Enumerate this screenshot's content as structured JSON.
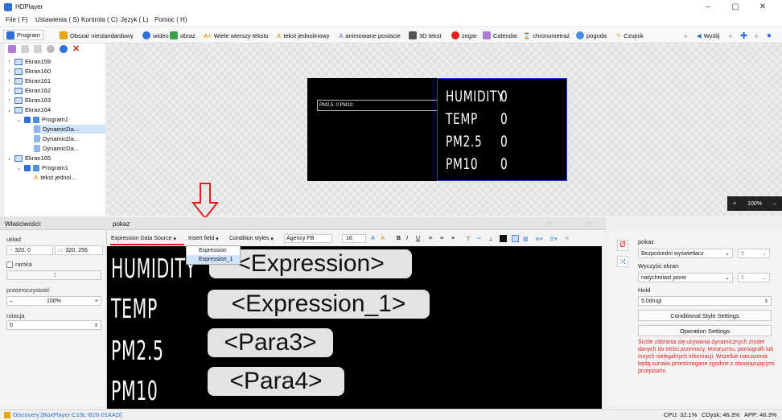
{
  "window": {
    "title": "HDPlayer",
    "controls": [
      "–",
      "▢",
      "✕"
    ]
  },
  "menu": [
    "File ( F)",
    "Ustawienia ( S)",
    "Kontrola ( C)",
    "Język ( L)",
    "Pomoc ( H)"
  ],
  "toolbar": {
    "program": "Program",
    "items": [
      "Obszar niestandardowy",
      "wideo",
      "obraz",
      "Wiele wierszy tekstu",
      "tekst jednolinowy",
      "animowane postacie",
      "3D tekst",
      "zegar",
      "Calendar",
      "chronometraż",
      "pogoda",
      "Czujnik"
    ],
    "send": "Wyślij"
  },
  "tree": [
    {
      "label": "Ekran159",
      "level": 0,
      "expanded": false
    },
    {
      "label": "Ekran160",
      "level": 0,
      "expanded": false
    },
    {
      "label": "Ekran161",
      "level": 0,
      "expanded": false
    },
    {
      "label": "Ekran162",
      "level": 0,
      "expanded": false
    },
    {
      "label": "Ekran163",
      "level": 0,
      "expanded": false
    },
    {
      "label": "Ekran164",
      "level": 0,
      "expanded": true
    },
    {
      "label": "Program1",
      "level": 1,
      "expanded": true
    },
    {
      "label": "DynamicDa...",
      "level": 2,
      "selected": true
    },
    {
      "label": "DynamicDa...",
      "level": 2
    },
    {
      "label": "DynamicDa...",
      "level": 2
    },
    {
      "label": "Ekran165",
      "level": 0,
      "expanded": true
    },
    {
      "label": "Program1",
      "level": 1,
      "expanded": true
    },
    {
      "label": "tekst jednol...",
      "level": 2,
      "text": true
    }
  ],
  "preview": {
    "box_text": "PM2.5: 0  PM10:",
    "rows": [
      {
        "label": "HUMIDITY",
        "value": "0"
      },
      {
        "label": "TEMP",
        "value": "0"
      },
      {
        "label": "PM2.5",
        "value": "0"
      },
      {
        "label": "PM10",
        "value": "0"
      }
    ],
    "zoom": "100%",
    "zoom_plus": "+",
    "zoom_minus": "–"
  },
  "properties": {
    "title": "Właściwości:",
    "layout_label": "układ",
    "x": "320, 0",
    "size": "320, 256",
    "frame_label": "ramka",
    "frame_value": "1",
    "transparency_label": "przezroczystość",
    "transparency_value": "100%",
    "rotation_label": "rotacja",
    "rotation_value": "0"
  },
  "editor": {
    "title": "pokaz",
    "toolbar": {
      "data_source": "Expression Data Source",
      "insert_field": "Insert field",
      "condition_styles": "Condition styles",
      "font": "Agency FB",
      "size": "16"
    },
    "dropdown_items": [
      "Expression",
      "Expression_1"
    ],
    "rows": [
      {
        "label": "HUMIDITY",
        "field": "<Expression>"
      },
      {
        "label": "TEMP",
        "field": "<Expression_1>"
      },
      {
        "label": "PM2.5",
        "field": "<Para3>"
      },
      {
        "label": "PM10",
        "field": "<Para4>"
      }
    ]
  },
  "right_panel": {
    "show_label": "pokaz",
    "show_value": "Bezpośredni wyświetlacz",
    "show_speed": "5",
    "clear_label": "Wyczyść ekran",
    "clear_value": "natychmiast jasne",
    "clear_speed": "5",
    "hold_label": "Hold",
    "hold_value": "5.0drugi",
    "cond_btn": "Conditional Style Settings",
    "op_btn": "Operation Settings",
    "warning": "Ściśle zabrania się używania dynamicznych źródeł danych do treści przemocy, terroryzmu, pornografii lub innych nielegalnych informacji. Wszelkie naruszenia będą surowo przestrzegane zgodnie z obowiązującymi przepisami."
  },
  "status": {
    "discovery": "Discovery:[BoxPlayer:C16L-B26-01AAD]",
    "cpu": "CPU: 32.1%",
    "cdisk": "CDysk: 46.3%",
    "app": "APP: 46.3%"
  },
  "colors": {
    "accent": "#2f6fd6",
    "warning": "#e02020",
    "arrow": "#e02020"
  }
}
